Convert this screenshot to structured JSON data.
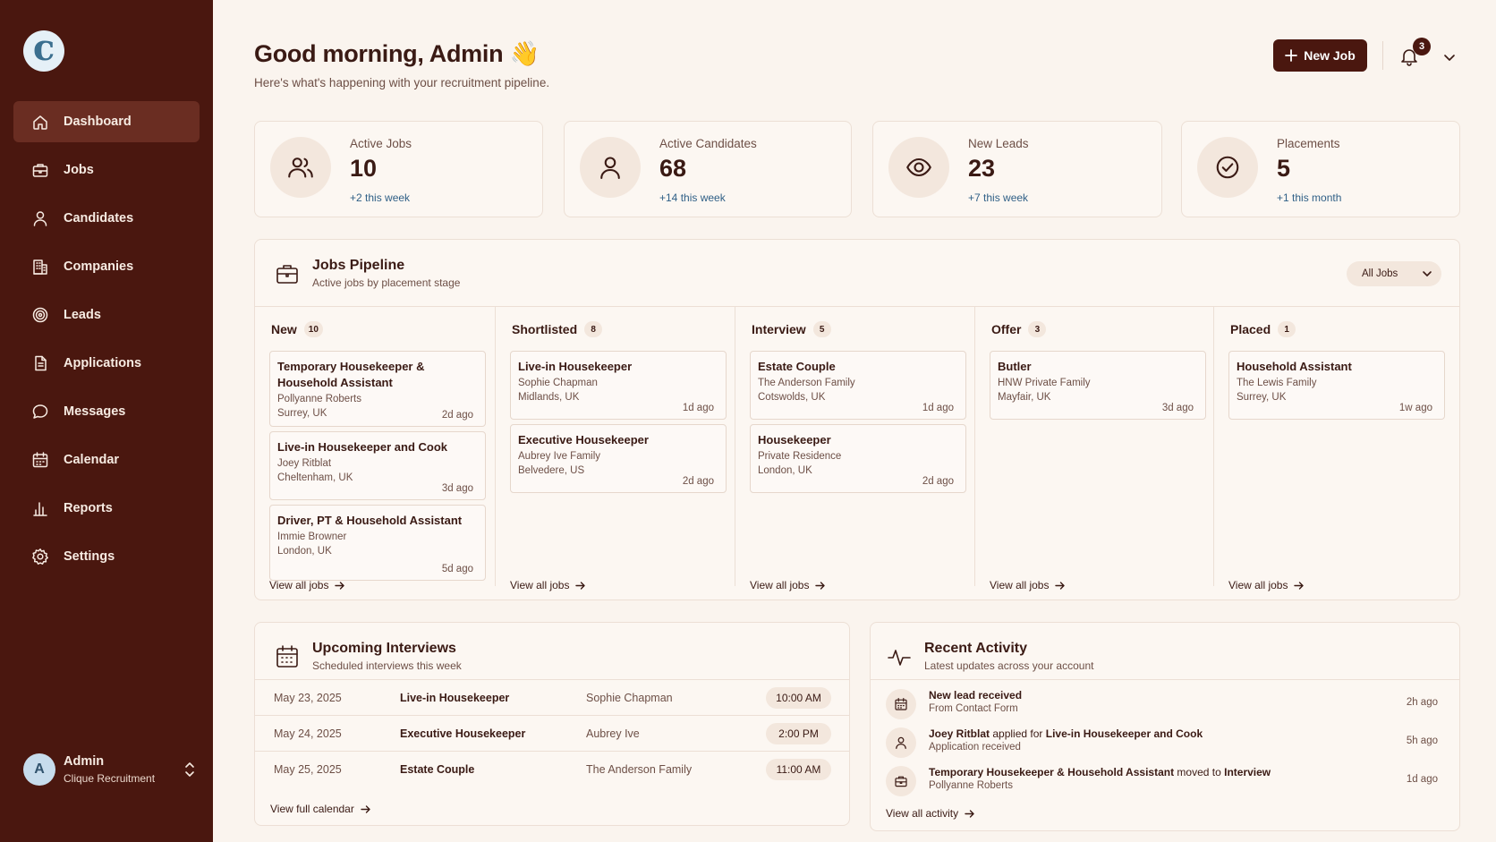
{
  "brand": {
    "logo_letter": "c"
  },
  "sidebar": {
    "items": [
      {
        "label": "Dashboard",
        "icon": "home-icon",
        "active": true
      },
      {
        "label": "Jobs",
        "icon": "briefcase-icon"
      },
      {
        "label": "Candidates",
        "icon": "user-icon"
      },
      {
        "label": "Companies",
        "icon": "building-icon"
      },
      {
        "label": "Leads",
        "icon": "target-icon"
      },
      {
        "label": "Applications",
        "icon": "document-icon"
      },
      {
        "label": "Messages",
        "icon": "chat-icon"
      },
      {
        "label": "Calendar",
        "icon": "calendar-icon"
      },
      {
        "label": "Reports",
        "icon": "bar-chart-icon"
      },
      {
        "label": "Settings",
        "icon": "gear-icon"
      }
    ],
    "user": {
      "initial": "A",
      "name": "Admin",
      "org": "Clique Recruitment"
    }
  },
  "header": {
    "greeting": "Good morning, Admin 👋",
    "subtitle": "Here's what's happening with your recruitment pipeline.",
    "new_job_label": "New Job",
    "notification_count": "3"
  },
  "stats": [
    {
      "label": "Active Jobs",
      "value": "10",
      "delta": "+2 this week",
      "icon": "users-icon"
    },
    {
      "label": "Active Candidates",
      "value": "68",
      "delta": "+14 this week",
      "icon": "user-icon"
    },
    {
      "label": "New Leads",
      "value": "23",
      "delta": "+7 this week",
      "icon": "eye-icon"
    },
    {
      "label": "Placements",
      "value": "5",
      "delta": "+1 this month",
      "icon": "check-circle-icon"
    }
  ],
  "pipeline": {
    "title": "Jobs Pipeline",
    "subtitle": "Active jobs by placement stage",
    "filter": "All Jobs",
    "view_all_label": "View all jobs",
    "columns": [
      {
        "title": "New",
        "count": "10",
        "jobs": [
          {
            "title": "Temporary Housekeeper & Household Assistant",
            "company": "Pollyanne Roberts",
            "location": "Surrey, UK",
            "age": "2d ago"
          },
          {
            "title": "Live-in Housekeeper and Cook",
            "company": "Joey Ritblat",
            "location": "Cheltenham, UK",
            "age": "3d ago"
          },
          {
            "title": "Driver, PT & Household Assistant",
            "company": "Immie Browner",
            "location": "London, UK",
            "age": "5d ago"
          }
        ]
      },
      {
        "title": "Shortlisted",
        "count": "8",
        "jobs": [
          {
            "title": "Live-in Housekeeper",
            "company": "Sophie Chapman",
            "location": "Midlands, UK",
            "age": "1d ago"
          },
          {
            "title": "Executive Housekeeper",
            "company": "Aubrey Ive Family",
            "location": "Belvedere, US",
            "age": "2d ago"
          }
        ]
      },
      {
        "title": "Interview",
        "count": "5",
        "jobs": [
          {
            "title": "Estate Couple",
            "company": "The Anderson Family",
            "location": "Cotswolds, UK",
            "age": "1d ago"
          },
          {
            "title": "Housekeeper",
            "company": "Private Residence",
            "location": "London, UK",
            "age": "2d ago"
          }
        ]
      },
      {
        "title": "Offer",
        "count": "3",
        "jobs": [
          {
            "title": "Butler",
            "company": "HNW Private Family",
            "location": "Mayfair, UK",
            "age": "3d ago"
          }
        ]
      },
      {
        "title": "Placed",
        "count": "1",
        "jobs": [
          {
            "title": "Household Assistant",
            "company": "The Lewis Family",
            "location": "Surrey, UK",
            "age": "1w ago"
          }
        ]
      }
    ]
  },
  "interviews": {
    "title": "Upcoming Interviews",
    "subtitle": "Scheduled interviews this week",
    "rows": [
      {
        "date": "May 23, 2025",
        "job": "Live-in Housekeeper",
        "candidate": "Sophie Chapman",
        "time": "10:00 AM"
      },
      {
        "date": "May 24, 2025",
        "job": "Executive Housekeeper",
        "candidate": "Aubrey Ive",
        "time": "2:00 PM"
      },
      {
        "date": "May 25, 2025",
        "job": "Estate Couple",
        "candidate": "The Anderson Family",
        "time": "11:00 AM"
      }
    ],
    "footer_link": "View full calendar"
  },
  "activity": {
    "title": "Recent Activity",
    "subtitle": "Latest updates across your account",
    "items": [
      {
        "icon": "calendar-icon",
        "parts": [
          [
            "b",
            "New lead received"
          ]
        ],
        "sub": "From Contact Form",
        "age": "2h ago"
      },
      {
        "icon": "user-icon",
        "parts": [
          [
            "b",
            "Joey Ritblat"
          ],
          [
            "n",
            " applied for "
          ],
          [
            "b",
            "Live-in Housekeeper and Cook"
          ]
        ],
        "sub": "Application received",
        "age": "5h ago"
      },
      {
        "icon": "briefcase-icon",
        "parts": [
          [
            "b",
            "Temporary Housekeeper & Household Assistant"
          ],
          [
            "n",
            " moved to "
          ],
          [
            "b",
            "Interview"
          ]
        ],
        "sub": "Pollyanne Roberts",
        "age": "1d ago"
      }
    ],
    "footer_link": "View all activity"
  }
}
